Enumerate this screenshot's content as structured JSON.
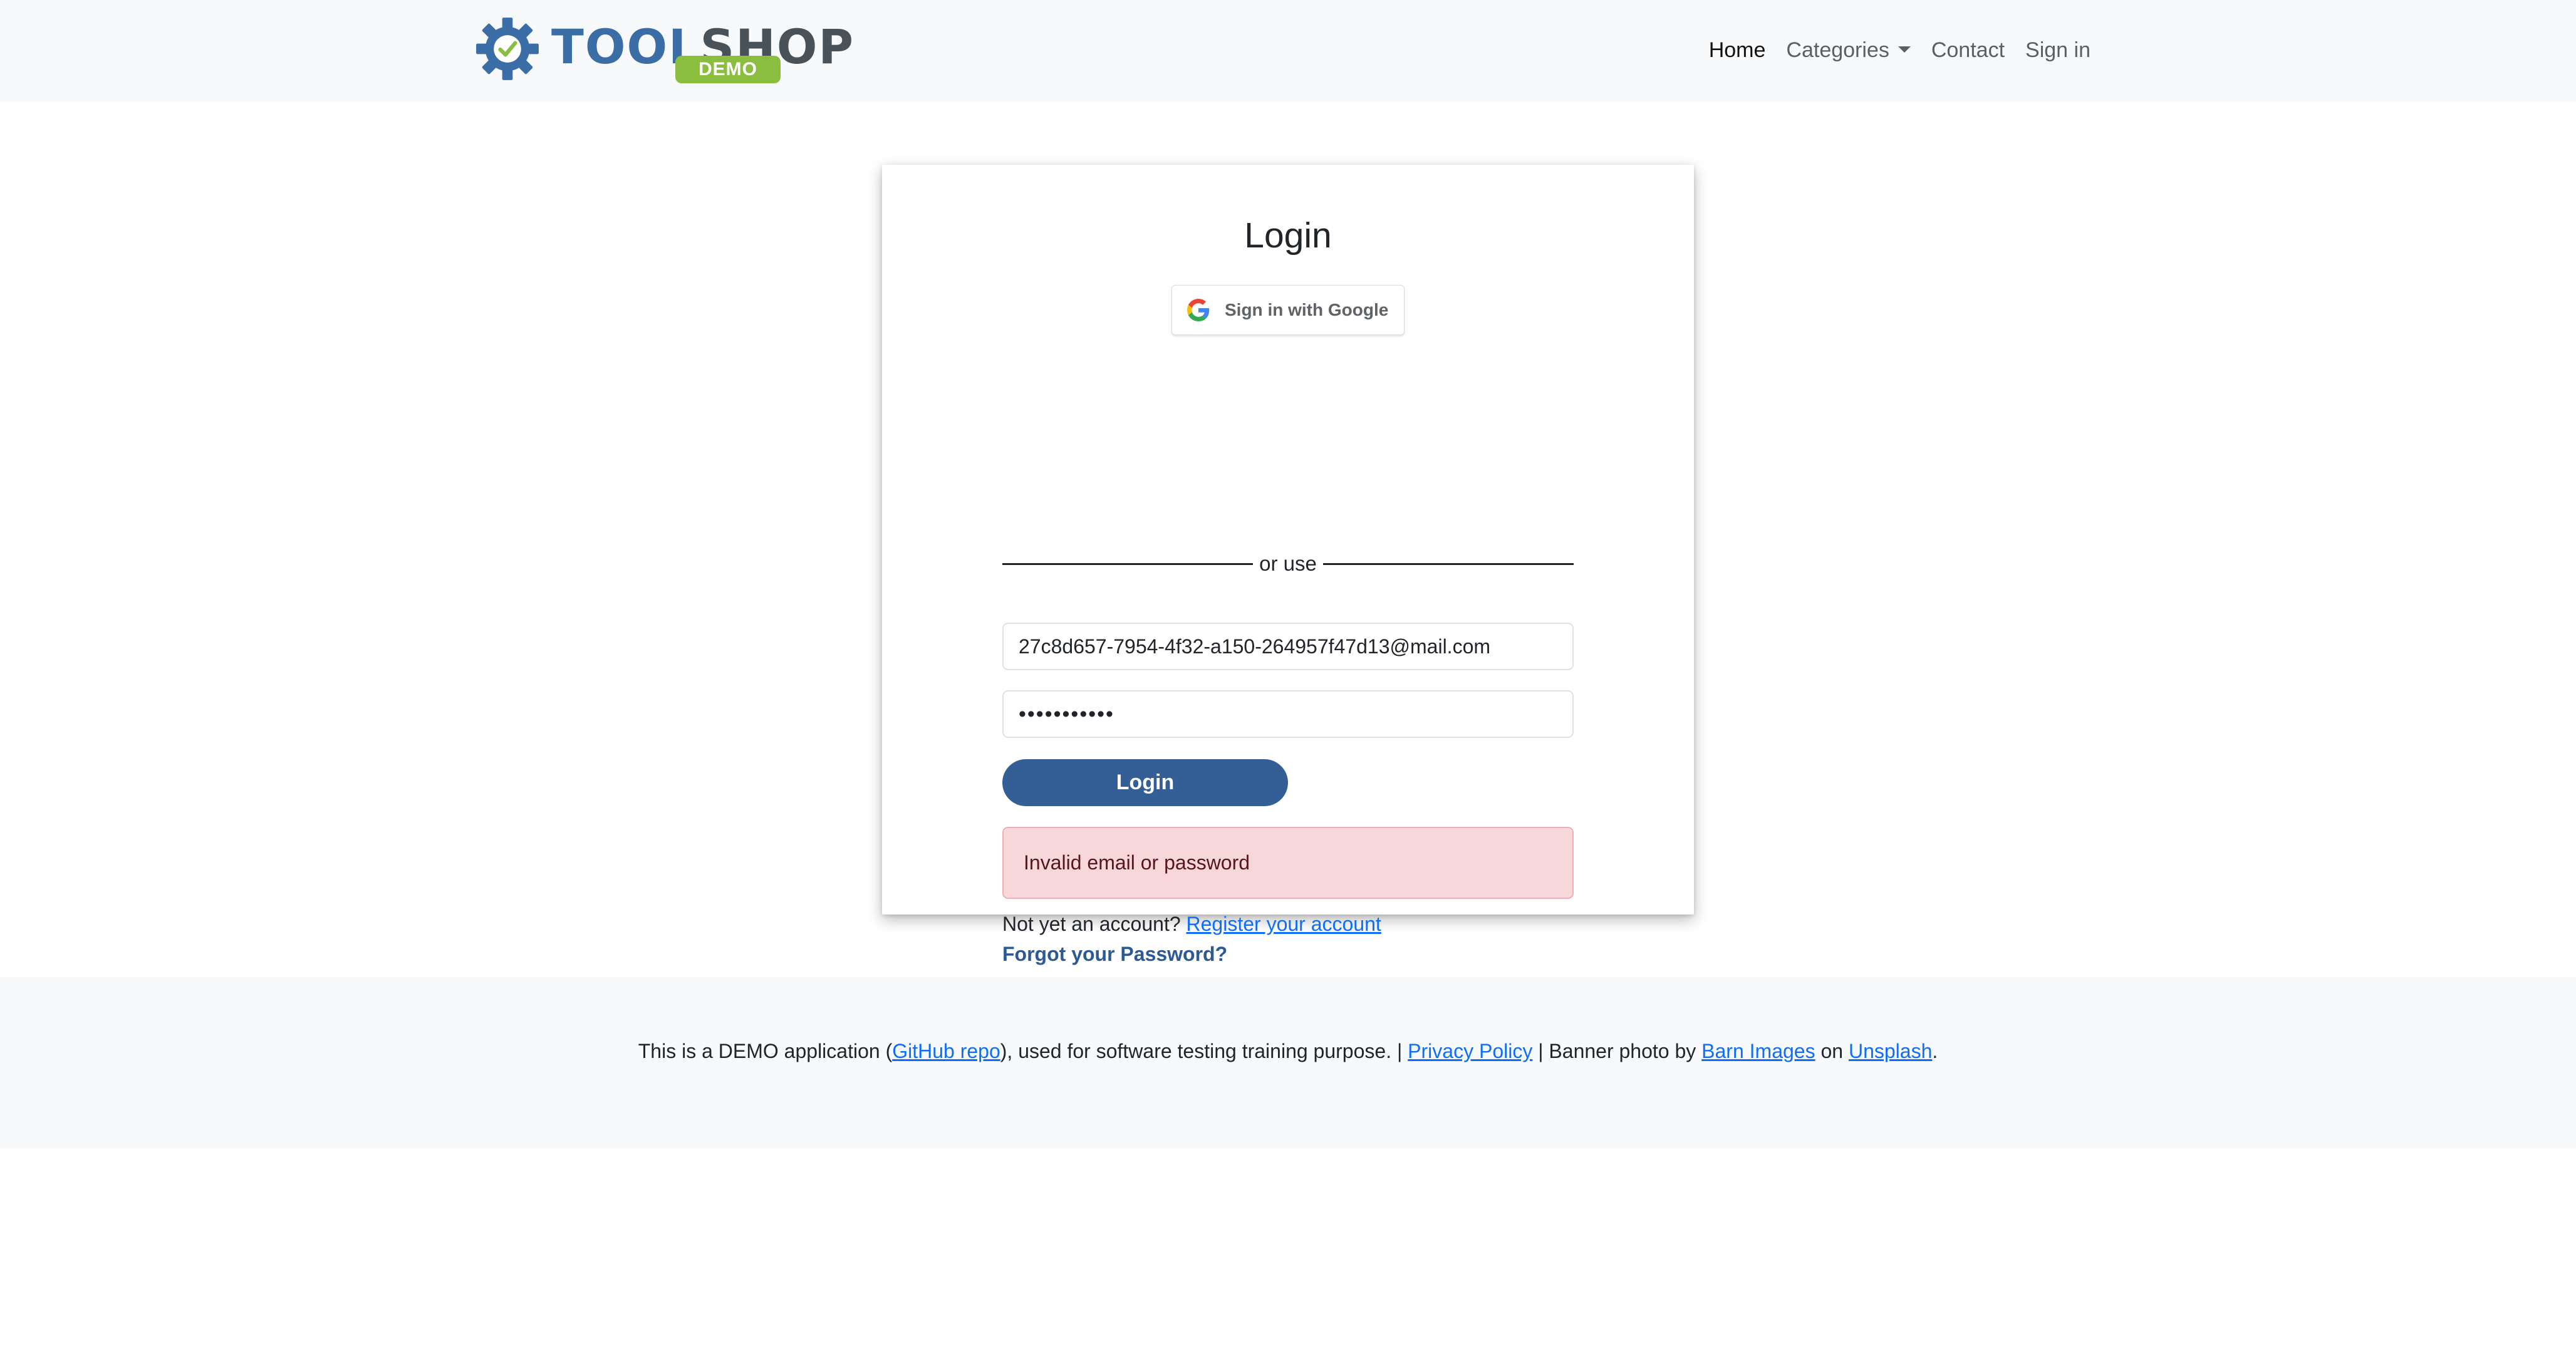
{
  "brand": {
    "name_part1": "TOOL",
    "name_part2": "SHOP",
    "badge": "DEMO",
    "colors": {
      "tool": "#3b6da6",
      "shop": "#4a5259",
      "badge": "#8bbd3f"
    }
  },
  "nav": {
    "home": "Home",
    "categories": "Categories",
    "contact": "Contact",
    "sign_in": "Sign in"
  },
  "login": {
    "title": "Login",
    "google_button": "Sign in with Google",
    "divider_text": "or use",
    "email_value": "27c8d657-7954-4f32-a150-264957f47d13@mail.com",
    "password_value": "•••••••••••",
    "submit_label": "Login",
    "error_message": "Invalid email or password",
    "register_prompt": "Not yet an account?",
    "register_link": "Register your account",
    "forgot_link": "Forgot your Password?"
  },
  "footer": {
    "text1": "This is a DEMO application (",
    "github_link": "GitHub repo",
    "text2": "), used for software testing training purpose. | ",
    "privacy_link": "Privacy Policy",
    "text3": " | Banner photo by ",
    "barn_link": "Barn Images",
    "text4": " on ",
    "unsplash_link": "Unsplash",
    "text5": "."
  }
}
